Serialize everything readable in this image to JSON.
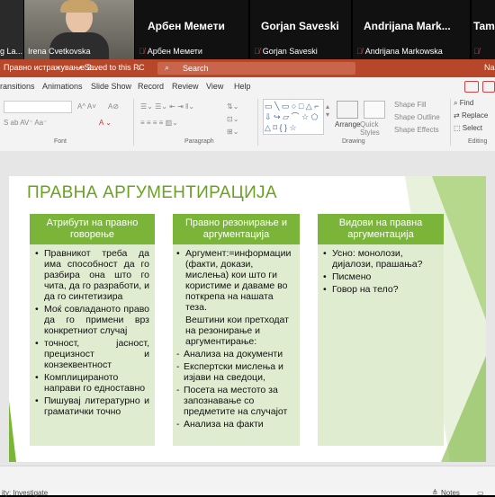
{
  "participants": [
    {
      "name": "g La..."
    },
    {
      "name": "Irena Cvetkovska"
    },
    {
      "display_name": "Арбен Мемети",
      "label": "Арбен Мемети"
    },
    {
      "display_name": "Gorjan Saveski",
      "label": "Gorjan Saveski"
    },
    {
      "display_name": "Andrijana Mark...",
      "label": "Andrijana Markowska"
    },
    {
      "display_name": "Tam",
      "label": "Tam"
    }
  ],
  "titlebar": {
    "doc_title": "Правно истражување 2...",
    "saved": "• Saved to this PC",
    "search_placeholder": "Search",
    "user_initial": "Na"
  },
  "menu": [
    "ransitions",
    "Animations",
    "Slide Show",
    "Record",
    "Review",
    "View",
    "Help"
  ],
  "ribbon": {
    "groups": [
      "Font",
      "Paragraph",
      "Drawing",
      "Editing"
    ],
    "arrange": "Arrange",
    "quick_styles": "Quick Styles",
    "shape_fill": "Shape Fill",
    "shape_outline": "Shape Outline",
    "shape_effects": "Shape Effects",
    "find": "Find",
    "replace": "Replace",
    "select": "Select"
  },
  "slide": {
    "title": "ПРАВНА АРГУМЕНТИРАЦИЈА",
    "columns": [
      {
        "header": "Атрибути на правно говорење",
        "items": [
          {
            "text": "Правникот треба да има способност да го разбира она што го чита, да го разработи, и да го синтетизира",
            "style": "bullet"
          },
          {
            "text": "Моќ совладаното право да го примени врз конкретниот случај",
            "style": "bullet"
          },
          {
            "text": "точност, јасност, прецизност и конзеквентност",
            "style": "bullet"
          },
          {
            "text": "Комплицираното направи го едноставно",
            "style": "bullet"
          },
          {
            "text": "Пишувај литературно и граматички точно",
            "style": "bullet"
          }
        ]
      },
      {
        "header": "Правно резонирање и аргументација",
        "items": [
          {
            "text": "Аргумент:=информации (факти, докази, мислења) кои што ги користиме и даваме во поткрепа на нашата теза.",
            "style": "bullet"
          },
          {
            "text": "Вештини кои претходат на резонирање и аргументирање:",
            "style": "plain"
          },
          {
            "text": "Анализа на документи",
            "style": "dash"
          },
          {
            "text": "Експертски мислења и изјави на сведоци,",
            "style": "dash"
          },
          {
            "text": "Посета на местото за запознавање со предметите на случајот",
            "style": "dash"
          },
          {
            "text": "Анализа на факти",
            "style": "dash"
          }
        ]
      },
      {
        "header": "Видови на правна аргументација",
        "items": [
          {
            "text": "Усно: монолози, дијалози, прашања?",
            "style": "bullet"
          },
          {
            "text": "Писмено",
            "style": "bullet"
          },
          {
            "text": "Говор на тело?",
            "style": "bullet"
          }
        ]
      }
    ]
  },
  "status": {
    "left": "ity: Investigate",
    "notes": "Notes"
  },
  "colors": {
    "accent": "#b7472a",
    "slide_green": "#7ab53a",
    "col_bg": "#dfeccf"
  }
}
